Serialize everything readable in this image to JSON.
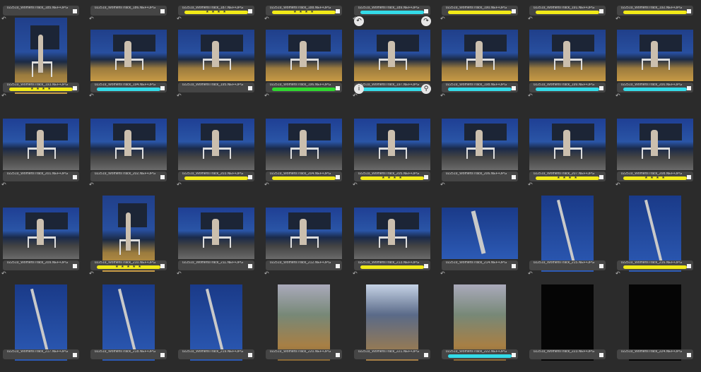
{
  "colors": {
    "yellow": "#f1ea18",
    "cyan": "#34dbe8",
    "green": "#2fd82f",
    "none": "#454545"
  },
  "stars": "★ ★ ★ ★",
  "stars5": "★ ★ ★ ★ ★",
  "rows": [
    [
      {
        "name": "022519_WomensTrack_185.NEF+JPG",
        "label": "none",
        "stars": ""
      },
      {
        "name": "022519_WomensTrack_186.NEF+JPG",
        "label": "none",
        "stars": ""
      },
      {
        "name": "022519_WomensTrack_187.NEF+JPG",
        "label": "yellow",
        "stars": "★ ★ ★ ★"
      },
      {
        "name": "022519_WomensTrack_188.NEF+JPG",
        "label": "yellow",
        "stars": "★ ★ ★ ★"
      },
      {
        "name": "022519_WomensTrack_189.NEF+JPG",
        "label": "cyan",
        "stars": ""
      },
      {
        "name": "022519_WomensTrack_190.NEF+JPG",
        "label": "yellow",
        "stars": ""
      },
      {
        "name": "022519_WomensTrack_191.NEF+JPG",
        "label": "yellow",
        "stars": ""
      },
      {
        "name": "022519_WomensTrack_192.NEF+JPG",
        "label": "yellow",
        "stars": ""
      }
    ],
    [
      {
        "name": "022519_WomensTrack_193.NEF+JPG",
        "label": "yellow",
        "stars": "★ ★ ★ ★",
        "img": "port-blue"
      },
      {
        "name": "022519_WomensTrack_194.NEF+JPG",
        "label": "cyan",
        "stars": "",
        "img": "land-blue"
      },
      {
        "name": "022519_WomensTrack_195.NEF+JPG",
        "label": "none",
        "stars": "",
        "img": "land-blue"
      },
      {
        "name": "022519_WomensTrack_196.NEF+JPG",
        "label": "green",
        "stars": "",
        "img": "land-blue"
      },
      {
        "name": "022519_WomensTrack_197.NEF+JPG",
        "label": "cyan",
        "stars": "",
        "img": "land-blue"
      },
      {
        "name": "022519_WomensTrack_198.NEF+JPG",
        "label": "cyan",
        "stars": "",
        "img": "land-blue"
      },
      {
        "name": "022519_WomensTrack_199.NEF+JPG",
        "label": "cyan",
        "stars": "",
        "img": "land-blue"
      },
      {
        "name": "022519_WomensTrack_200.NEF+JPG",
        "label": "cyan",
        "stars": "",
        "img": "land-blue"
      }
    ],
    [
      {
        "name": "022519_WomensTrack_201.NEF+JPG",
        "label": "none",
        "stars": "",
        "img": "land-night"
      },
      {
        "name": "022519_WomensTrack_202.NEF+JPG",
        "label": "none",
        "stars": "",
        "img": "land-night"
      },
      {
        "name": "022519_WomensTrack_203.NEF+JPG",
        "label": "yellow",
        "stars": "",
        "img": "land-night"
      },
      {
        "name": "022519_WomensTrack_204.NEF+JPG",
        "label": "yellow",
        "stars": "",
        "img": "land-night"
      },
      {
        "name": "022519_WomensTrack_205.NEF+JPG",
        "label": "yellow",
        "stars": "★ ★ ★ ★",
        "img": "land-night"
      },
      {
        "name": "022519_WomensTrack_206.NEF+JPG",
        "label": "none",
        "stars": "",
        "img": "land-night"
      },
      {
        "name": "022519_WomensTrack_207.NEF+JPG",
        "label": "yellow",
        "stars": "★ ★ ★ ★",
        "img": "land-night"
      },
      {
        "name": "022519_WomensTrack_208.NEF+JPG",
        "label": "yellow",
        "stars": "★ ★ ★ ★",
        "img": "land-night"
      }
    ],
    [
      {
        "name": "022519_WomensTrack_209.NEF+JPG",
        "label": "none",
        "stars": "",
        "img": "land-night"
      },
      {
        "name": "022519_WomensTrack_210.NEF+JPG",
        "label": "yellow",
        "stars": "★ ★ ★ ★ ★",
        "img": "port-blue"
      },
      {
        "name": "022519_WomensTrack_211.NEF+JPG",
        "label": "none",
        "stars": "",
        "img": "land-night"
      },
      {
        "name": "022519_WomensTrack_212.NEF+JPG",
        "label": "none",
        "stars": "",
        "img": "land-night"
      },
      {
        "name": "022519_WomensTrack_213.NEF+JPG",
        "label": "yellow",
        "stars": "",
        "img": "land-night"
      },
      {
        "name": "022519_WomensTrack_214.NEF+JPG",
        "label": "none",
        "stars": "",
        "img": "land-sky"
      },
      {
        "name": "022519_WomensTrack_215.NEF+JPG",
        "label": "none",
        "stars": "",
        "img": "port-sky"
      },
      {
        "name": "022519_WomensTrack_216.NEF+JPG",
        "label": "yellow",
        "stars": "",
        "img": "port-sky"
      }
    ],
    [
      {
        "name": "022519_WomensTrack_217.NEF+JPG",
        "label": "none",
        "stars": "",
        "img": "port-sky"
      },
      {
        "name": "022519_WomensTrack_218.NEF+JPG",
        "label": "none",
        "stars": "",
        "img": "port-sky"
      },
      {
        "name": "022519_WomensTrack_219.NEF+JPG",
        "label": "none",
        "stars": "",
        "img": "port-sky"
      },
      {
        "name": "022519_WomensTrack_220.NEF+JPG",
        "label": "none",
        "stars": "",
        "img": "port-team"
      },
      {
        "name": "022519_WomensTrack_221.NEF+JPG",
        "label": "none",
        "stars": "",
        "img": "port-team2"
      },
      {
        "name": "022519_WomensTrack_222.NEF+JPG",
        "label": "cyan",
        "stars": "",
        "img": "port-team"
      },
      {
        "name": "022519_WomensTrack_223.NEF+JPG",
        "label": "none",
        "stars": "",
        "img": "port-black"
      },
      {
        "name": "022519_WomensTrack_224.NEF+JPG",
        "label": "none",
        "stars": "",
        "img": "port-black"
      }
    ]
  ],
  "hover": {
    "rotate_left": "↶",
    "rotate_right": "↷",
    "info": "i",
    "zoom": "⚲"
  }
}
